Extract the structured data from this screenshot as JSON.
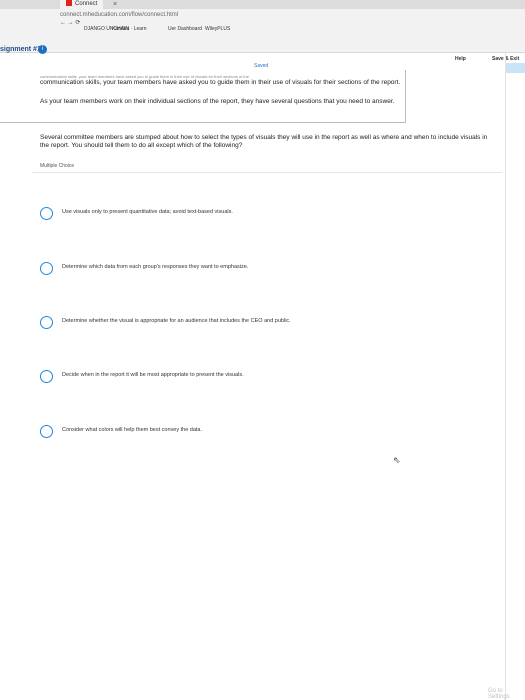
{
  "browser": {
    "tab_title": "Connect",
    "close_glyph": "×",
    "url": "connect.mheducation.com/flow/connect.html",
    "toolbar": "← → ⟳",
    "bookmarks": [
      "DJANGO UNCHAIN",
      "Kandan · Learn",
      "Uer Dashboard",
      "WileyPLUS"
    ]
  },
  "header": {
    "assignment": "signment #1",
    "badge": "i",
    "help": "Help",
    "save_exit": "Save & Exit",
    "saved": "Saved"
  },
  "question": {
    "intro": "communication skills, your team members have asked you to guide them in their use of visuals for their sections of the",
    "para1": "communication skills, your team members have asked you to guide them in their use of visuals for their sections of the report.",
    "para2": "As your team members work on their individual sections of the report, they have several questions that you need to answer.",
    "stem": "Several committee members are stumped about how to select the types of visuals they will use in the report as well as where and when to include visuals in the report. You should tell them to do all except which of the following?",
    "type_label": "Multiple Choice",
    "options": [
      "Use visuals only to present quantitative data; avoid text-based visuals.",
      "Determine which data from each group's responses they want to emphasize.",
      "Determine whether the visual is appropriate for an audience that includes the CEO and public.",
      "Decide when in the report it will be most appropriate to present the visuals.",
      "Consider what colors will help them best convey the data."
    ]
  },
  "cursor_glyph": "⇖",
  "watermark": "Go to Settings"
}
